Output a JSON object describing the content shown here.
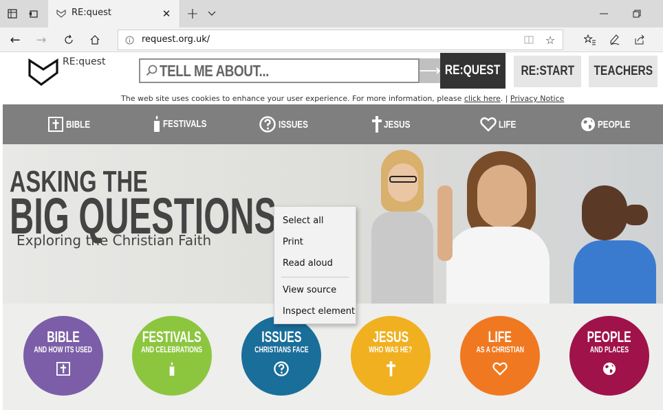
{
  "browser": {
    "tab_title": "RE:quest",
    "url": "request.org.uk/"
  },
  "site": {
    "logo_text": "RE:quest",
    "search_placeholder": "TELL ME ABOUT...",
    "buttons": {
      "request": "RE:QUEST",
      "restart": "RE:START",
      "teachers": "TEACHERS"
    },
    "cookie": {
      "text": "The web site uses cookies to enhance your user experience. For more information, please ",
      "link": "click here",
      "sep": ". | ",
      "privacy": "Privacy Notice"
    },
    "nav": [
      {
        "label": "BIBLE",
        "icon": "bible-icon"
      },
      {
        "label": "FESTIVALS",
        "icon": "candle-icon"
      },
      {
        "label": "ISSUES",
        "icon": "question-icon"
      },
      {
        "label": "JESUS",
        "icon": "cross-icon"
      },
      {
        "label": "LIFE",
        "icon": "heart-icon"
      },
      {
        "label": "PEOPLE",
        "icon": "globe-icon"
      }
    ],
    "hero": {
      "line1": "ASKING THE",
      "line2": "BIG QUESTIONS",
      "line3": "Exploring the Christian Faith"
    },
    "circles": [
      {
        "title": "BIBLE",
        "sub": "AND HOW ITS USED",
        "color": "#7b5ea7"
      },
      {
        "title": "FESTIVALS",
        "sub": "AND CELEBRATIONS",
        "color": "#8cc63f"
      },
      {
        "title": "ISSUES",
        "sub": "CHRISTIANS FACE",
        "color": "#1a6e9a"
      },
      {
        "title": "JESUS",
        "sub": "WHO WAS HE?",
        "color": "#f0b020"
      },
      {
        "title": "LIFE",
        "sub": "AS A CHRISTIAN",
        "color": "#f07820"
      },
      {
        "title": "PEOPLE",
        "sub": "AND PLACES",
        "color": "#a0124a"
      }
    ]
  },
  "context_menu": {
    "items": [
      "Select all",
      "Print",
      "Read aloud",
      "View source",
      "Inspect element"
    ]
  }
}
